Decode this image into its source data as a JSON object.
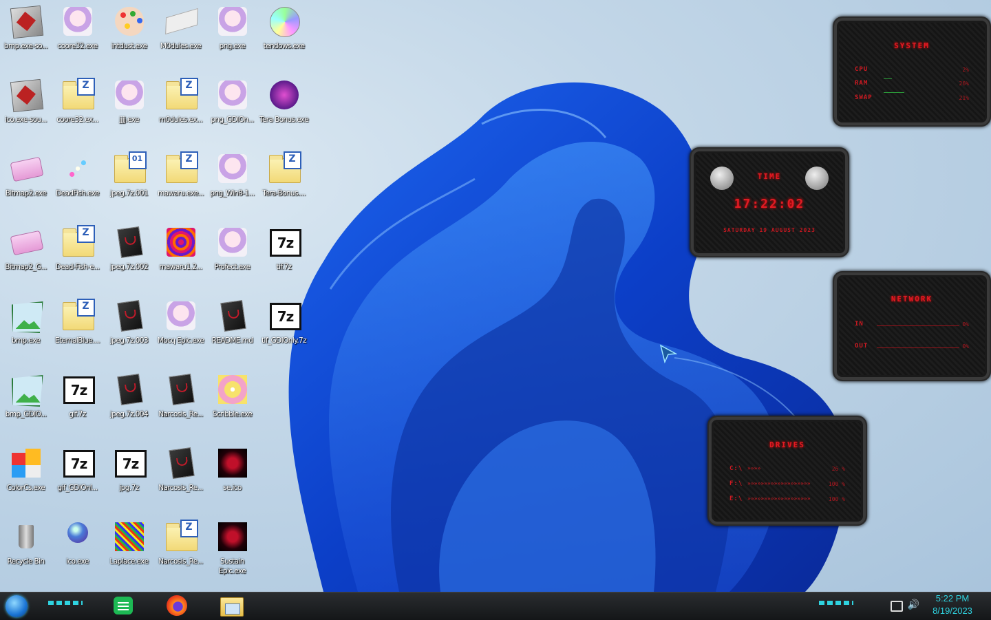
{
  "desktop_icons": [
    {
      "label": "bmp.exe-so...",
      "col": 0,
      "row": 0,
      "kind": "app-red"
    },
    {
      "label": "coore32.exe",
      "col": 1,
      "row": 0,
      "kind": "anime"
    },
    {
      "label": "intdust.exe",
      "col": 2,
      "row": 0,
      "kind": "palette"
    },
    {
      "label": "M0dules.exe",
      "col": 3,
      "row": 0,
      "kind": "paper"
    },
    {
      "label": "png.exe",
      "col": 4,
      "row": 0,
      "kind": "anime"
    },
    {
      "label": "tendows.exe",
      "col": 5,
      "row": 0,
      "kind": "disc"
    },
    {
      "label": "ico.exe-sou...",
      "col": 0,
      "row": 1,
      "kind": "app-red"
    },
    {
      "label": "coore32.ex...",
      "col": 1,
      "row": 1,
      "kind": "folder-z"
    },
    {
      "label": "jjjj.exe",
      "col": 2,
      "row": 1,
      "kind": "anime"
    },
    {
      "label": "m0dules.ex...",
      "col": 3,
      "row": 1,
      "kind": "folder-z"
    },
    {
      "label": "png_GDIOn...",
      "col": 4,
      "row": 1,
      "kind": "anime"
    },
    {
      "label": "Tera Bonus.exe",
      "col": 5,
      "row": 1,
      "kind": "purple"
    },
    {
      "label": "Bitmap2.exe",
      "col": 0,
      "row": 2,
      "kind": "eraser"
    },
    {
      "label": "DeadFish.exe",
      "col": 1,
      "row": 2,
      "kind": "sparkle"
    },
    {
      "label": "jpeg.7z.001",
      "col": 2,
      "row": 2,
      "kind": "folder-01"
    },
    {
      "label": "mawaru.exe...",
      "col": 3,
      "row": 2,
      "kind": "folder-z"
    },
    {
      "label": "png_Win8-1...",
      "col": 4,
      "row": 2,
      "kind": "anime"
    },
    {
      "label": "Tera-Bonus....",
      "col": 5,
      "row": 2,
      "kind": "folder-z"
    },
    {
      "label": "Bitmap2_G...",
      "col": 0,
      "row": 3,
      "kind": "eraser"
    },
    {
      "label": "Dead-Fish-e...",
      "col": 1,
      "row": 3,
      "kind": "folder-z"
    },
    {
      "label": "jpeg.7z.002",
      "col": 2,
      "row": 3,
      "kind": "doc"
    },
    {
      "label": "mawaru1.2...",
      "col": 3,
      "row": 3,
      "kind": "psyche"
    },
    {
      "label": "Profect.exe",
      "col": 4,
      "row": 3,
      "kind": "anime"
    },
    {
      "label": "tif.7z",
      "col": 5,
      "row": 3,
      "kind": "7z"
    },
    {
      "label": "bmp.exe",
      "col": 0,
      "row": 4,
      "kind": "image"
    },
    {
      "label": "EternalBlue....",
      "col": 1,
      "row": 4,
      "kind": "folder-z"
    },
    {
      "label": "jpeg.7z.003",
      "col": 2,
      "row": 4,
      "kind": "doc"
    },
    {
      "label": "Mocq Epic.exe",
      "col": 3,
      "row": 4,
      "kind": "anime"
    },
    {
      "label": "README.md",
      "col": 4,
      "row": 4,
      "kind": "doc"
    },
    {
      "label": "tif_GDIOnly.7z",
      "col": 5,
      "row": 4,
      "kind": "7z"
    },
    {
      "label": "bmp_GDIO...",
      "col": 0,
      "row": 5,
      "kind": "image"
    },
    {
      "label": "gif.7z",
      "col": 1,
      "row": 5,
      "kind": "7z"
    },
    {
      "label": "jpeg.7z.004",
      "col": 2,
      "row": 5,
      "kind": "doc"
    },
    {
      "label": "Narcosis_Re...",
      "col": 3,
      "row": 5,
      "kind": "doc"
    },
    {
      "label": "Scribble.exe",
      "col": 4,
      "row": 5,
      "kind": "yellow"
    },
    {
      "label": "ColorCs.exe",
      "col": 0,
      "row": 6,
      "kind": "colors"
    },
    {
      "label": "gif_GDIOnl...",
      "col": 1,
      "row": 6,
      "kind": "7z"
    },
    {
      "label": "jpg.7z",
      "col": 2,
      "row": 6,
      "kind": "7z"
    },
    {
      "label": "Narcosis_Re...",
      "col": 3,
      "row": 6,
      "kind": "doc"
    },
    {
      "label": "se.ico",
      "col": 4,
      "row": 6,
      "kind": "dark"
    },
    {
      "label": "Recycle Bin",
      "col": 0,
      "row": 7,
      "kind": "bin"
    },
    {
      "label": "ico.exe",
      "col": 1,
      "row": 7,
      "kind": "globe"
    },
    {
      "label": "Laplace.exe",
      "col": 2,
      "row": 7,
      "kind": "noise"
    },
    {
      "label": "Narcosis_Re...",
      "col": 3,
      "row": 7,
      "kind": "folder-z"
    },
    {
      "label": "Sustain Epic.exe",
      "col": 4,
      "row": 7,
      "kind": "dark"
    }
  ],
  "widgets": {
    "system": {
      "title": "SYSTEM",
      "rows": [
        {
          "label": "CPU",
          "value": "2%"
        },
        {
          "label": "RAM",
          "value": "26%"
        },
        {
          "label": "SWAP",
          "value": "21%"
        }
      ]
    },
    "time": {
      "title": "TIME",
      "clock": "17:22:02",
      "date": "SATURDAY 19 AUGUST 2023"
    },
    "network": {
      "title": "NETWORK",
      "rows": [
        {
          "label": "IN",
          "value": "0%"
        },
        {
          "label": "OUT",
          "value": "0%"
        }
      ]
    },
    "drives": {
      "title": "DRIVES",
      "rows": [
        {
          "label": "C:\\",
          "bar": "»»»»",
          "value": "26 %"
        },
        {
          "label": "F:\\",
          "bar": "»»»»»»»»»»»»»»»»»»»",
          "value": "100 %"
        },
        {
          "label": "E:\\",
          "bar": "»»»»»»»»»»»»»»»»»»»",
          "value": "100 %"
        }
      ]
    }
  },
  "taskbar": {
    "time": "5:22 PM",
    "date": "8/19/2023",
    "apps": [
      "start-orb-icon",
      "notes-app-icon",
      "firefox-icon",
      "file-explorer-icon"
    ]
  },
  "colors": {
    "accent_red": "#e01b24",
    "clock_cyan": "#2fd3e0",
    "bloom_blue": "#1b5be6"
  }
}
